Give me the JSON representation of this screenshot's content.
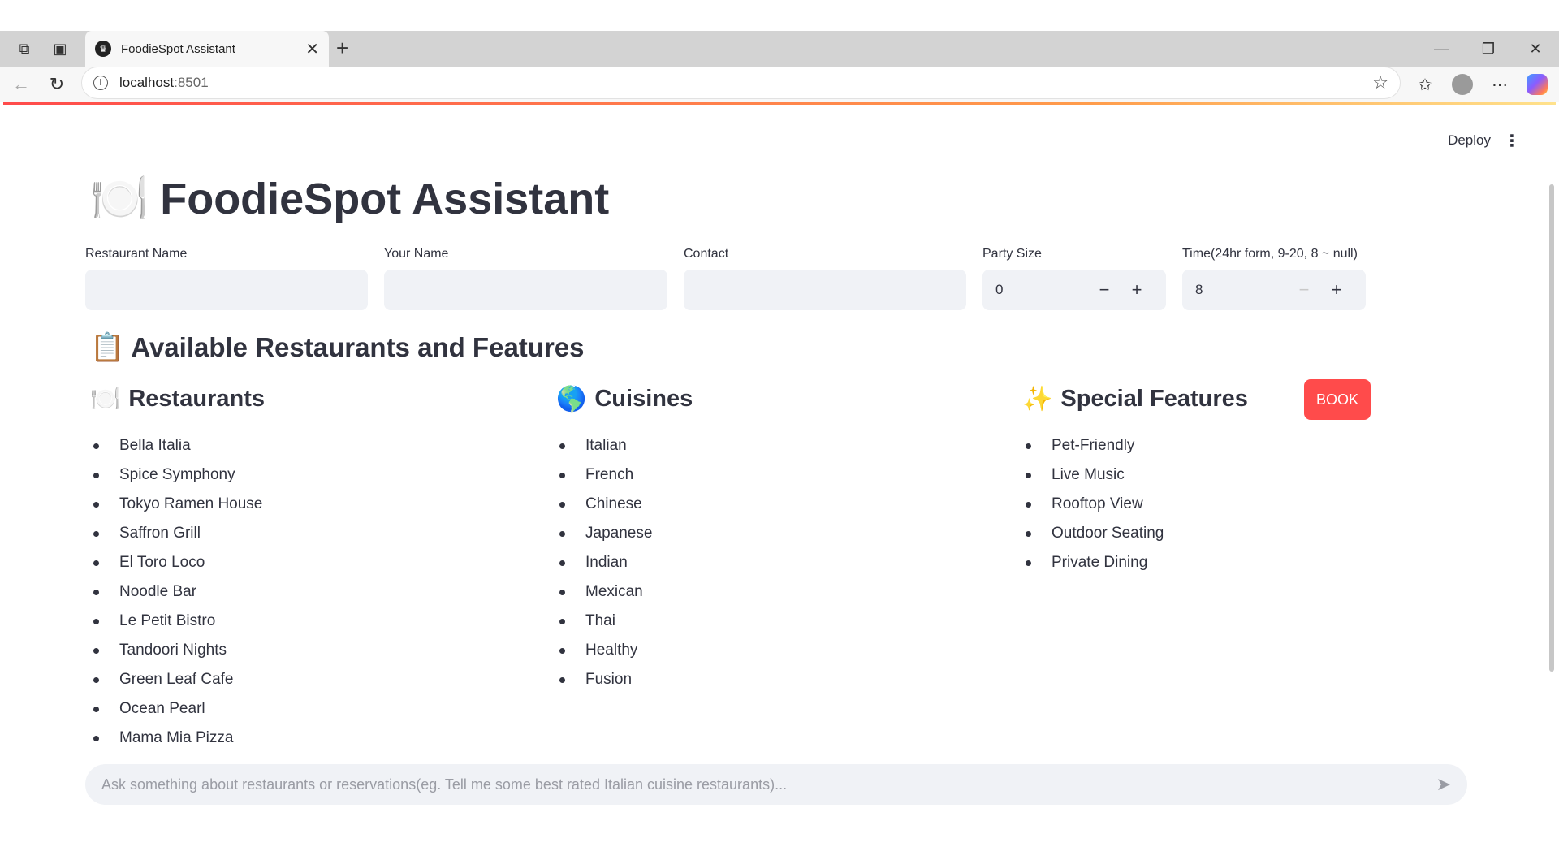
{
  "browser": {
    "tab_title": "FoodieSpot Assistant",
    "url_host": "localhost",
    "url_port": ":8501"
  },
  "app": {
    "deploy_label": "Deploy",
    "title_emoji": "🍽️",
    "title": "FoodieSpot Assistant"
  },
  "form": {
    "restaurant_name_label": "Restaurant Name",
    "restaurant_name_value": "",
    "your_name_label": "Your Name",
    "your_name_value": "",
    "contact_label": "Contact",
    "contact_value": "",
    "party_size_label": "Party Size",
    "party_size_value": "0",
    "time_label": "Time(24hr form, 9-20, 8 ~ null)",
    "time_value": "8",
    "book_label": "BOOK"
  },
  "section": {
    "emoji": "📋",
    "title": "Available Restaurants and Features"
  },
  "restaurants": {
    "emoji": "🍽️",
    "title": "Restaurants",
    "items": [
      "Bella Italia",
      "Spice Symphony",
      "Tokyo Ramen House",
      "Saffron Grill",
      "El Toro Loco",
      "Noodle Bar",
      "Le Petit Bistro",
      "Tandoori Nights",
      "Green Leaf Cafe",
      "Ocean Pearl",
      "Mama Mia Pizza"
    ]
  },
  "cuisines": {
    "emoji": "🌎",
    "title": "Cuisines",
    "items": [
      "Italian",
      "French",
      "Chinese",
      "Japanese",
      "Indian",
      "Mexican",
      "Thai",
      "Healthy",
      "Fusion"
    ]
  },
  "features": {
    "emoji": "✨",
    "title": "Special Features",
    "items": [
      "Pet-Friendly",
      "Live Music",
      "Rooftop View",
      "Outdoor Seating",
      "Private Dining"
    ]
  },
  "chat": {
    "placeholder": "Ask something about restaurants or reservations(eg. Tell me some best rated Italian cuisine restaurants)..."
  },
  "colors": {
    "accent": "#ff4b4b",
    "input_bg": "#f0f2f6",
    "text": "#31333f"
  }
}
